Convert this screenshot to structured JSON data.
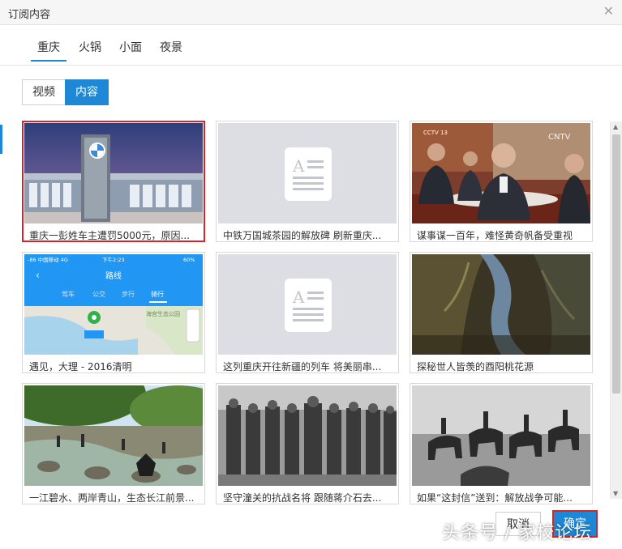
{
  "dialog": {
    "title": "订阅内容"
  },
  "tabs": [
    {
      "label": "重庆",
      "active": true
    },
    {
      "label": "火锅"
    },
    {
      "label": "小面"
    },
    {
      "label": "夜景"
    }
  ],
  "content_type": {
    "options": [
      "视频",
      "内容"
    ],
    "selected": "内容"
  },
  "phone": {
    "status_left": "-86 中国移动  4G",
    "time": "下午2:23",
    "battery": "60%",
    "route_title": "路线",
    "modes": [
      "驾车",
      "公交",
      "步行",
      "骑行"
    ],
    "map_label": "海宫生态公园"
  },
  "tv_logo": "CNTV",
  "tv_channel": "CCTV 13",
  "cards": [
    {
      "caption": "重庆一彭姓车主遭罚5000元，原因...",
      "selected": true
    },
    {
      "caption": "中铁万国城茶园的解放碑 刷新重庆..."
    },
    {
      "caption": "谋事谋一百年，难怪黄奇帆备受重视"
    },
    {
      "caption": "遇见，大理 - 2016清明"
    },
    {
      "caption": "这列重庆开往新疆的列车 将美丽串..."
    },
    {
      "caption": "探秘世人皆羡的酉阳桃花源"
    },
    {
      "caption": "一江碧水、两岸青山，生态长江前景..."
    },
    {
      "caption": "坚守潼关的抗战名将 跟随蒋介石去..."
    },
    {
      "caption": "如果“这封信”送到：解放战争可能..."
    }
  ],
  "buttons": {
    "cancel": "取消",
    "ok": "确定"
  },
  "watermark": "头条号 / 家校论坛",
  "colors": {
    "accent": "#1e88d6",
    "highlight": "#d0262b"
  }
}
